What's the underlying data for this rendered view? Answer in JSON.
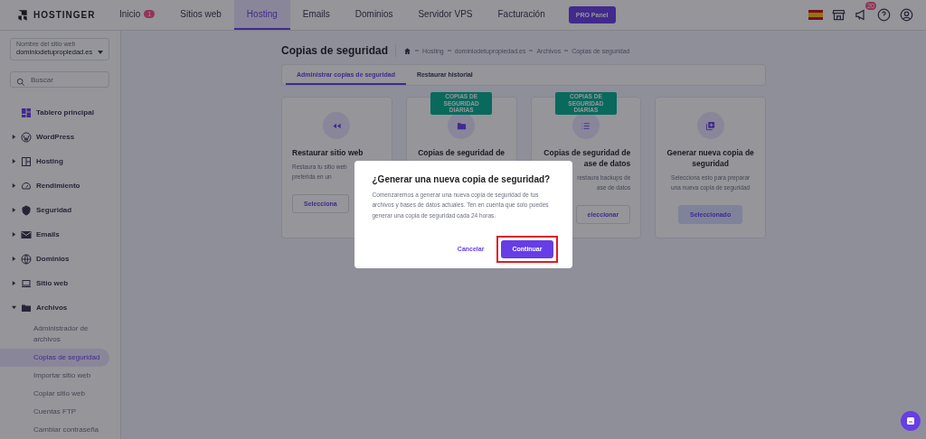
{
  "header": {
    "logo": "HOSTINGER",
    "nav": [
      {
        "label": "Inicio",
        "badge": "1",
        "selected": false
      },
      {
        "label": "Sitios web",
        "selected": false
      },
      {
        "label": "Hosting",
        "selected": true
      },
      {
        "label": "Emails",
        "selected": false
      },
      {
        "label": "Dominios",
        "selected": false
      },
      {
        "label": "Servidor VPS",
        "selected": false
      },
      {
        "label": "Facturación",
        "selected": false
      }
    ],
    "pro_button": "PRO Panel",
    "notification_badge": "20"
  },
  "sidebar": {
    "site_select": {
      "label": "Nombre del sitio web",
      "value": "dominiodetupropiedad.es"
    },
    "search": {
      "placeholder": "Buscar"
    },
    "items": [
      {
        "label": "Tablero principal",
        "kind": "link"
      },
      {
        "label": "WordPress",
        "kind": "group",
        "expanded": false
      },
      {
        "label": "Hosting",
        "kind": "group",
        "expanded": false
      },
      {
        "label": "Rendimiento",
        "kind": "group",
        "expanded": false
      },
      {
        "label": "Seguridad",
        "kind": "group",
        "expanded": false
      },
      {
        "label": "Emails",
        "kind": "group",
        "expanded": false
      },
      {
        "label": "Dominios",
        "kind": "group",
        "expanded": false
      },
      {
        "label": "Sitio web",
        "kind": "group",
        "expanded": false
      },
      {
        "label": "Archivos",
        "kind": "group",
        "expanded": true,
        "children": [
          {
            "label": "Administrador de archivos",
            "selected": false
          },
          {
            "label": "Copias de seguridad",
            "selected": true
          },
          {
            "label": "Importar sitio web",
            "selected": false
          },
          {
            "label": "Copiar sitio web",
            "selected": false
          },
          {
            "label": "Cuentas FTP",
            "selected": false
          },
          {
            "label": "Cambiar contraseña",
            "selected": false
          }
        ]
      }
    ]
  },
  "main": {
    "title": "Copias de seguridad",
    "breadcrumb": [
      "Hosting",
      "dominiodetupropiedad.es",
      "Archivos",
      "Copias de seguridad"
    ],
    "tabs": [
      {
        "label": "Administrar copias de seguridad",
        "selected": true
      },
      {
        "label": "Restaurar historial",
        "selected": false
      }
    ],
    "cards": [
      {
        "title_lines": [
          "Restaurar sitio web"
        ],
        "description": [
          "Restaura tu sitio web",
          "preferida en un"
        ],
        "button": {
          "label": "Selecciona",
          "selected": false
        }
      },
      {
        "badge": "COPIAS DE SEGURIDAD DIARIAS",
        "title_lines": [
          "Copias de seguridad de"
        ]
      },
      {
        "badge": "COPIAS DE SEGURIDAD DIARIAS",
        "title_lines": [
          "Copias de seguridad de",
          "ase de datos"
        ],
        "description": [
          "restaura backups de",
          "ase de datos"
        ],
        "button": {
          "label": "eleccionar",
          "selected": false
        }
      },
      {
        "title_lines": [
          "Generar nueva copia de seguridad"
        ],
        "description": [
          "Selecciona esto para preparar una nueva copia de seguridad"
        ],
        "button": {
          "label": "Seleccionado",
          "selected": true
        }
      }
    ]
  },
  "dialog": {
    "title": "¿Generar una nueva copia de seguridad?",
    "body": "Comenzaremos a generar una nueva copia de seguridad de tus archivos y bases de datos actuales. Ten en cuenta que solo puedes generar una copia de seguridad cada 24 horas.",
    "cancel": "Cancelar",
    "confirm": {
      "label": "Continuar",
      "highlighted": true
    }
  }
}
